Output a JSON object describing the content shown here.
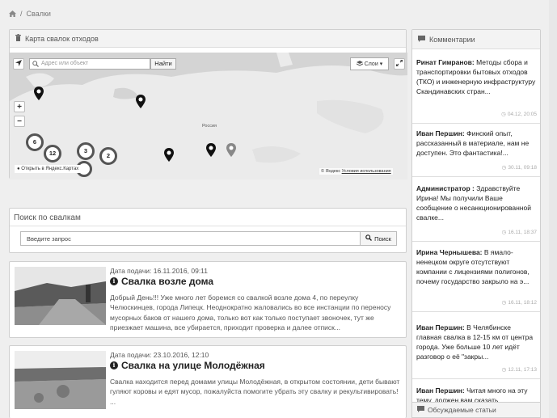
{
  "breadcrumb": {
    "separator": "/",
    "current": "Свалки"
  },
  "map_panel": {
    "title": "Карта свалок отходов",
    "search_placeholder": "Адрес или объект",
    "find_button": "Найти",
    "layers_button": "Слои",
    "zoom_in": "+",
    "zoom_out": "−",
    "clusters": [
      "6",
      "12",
      "3",
      "2"
    ],
    "country_label": "Россия",
    "open_link": "Открыть в Яндекс.Картах",
    "copyright": "© Яндекс",
    "terms": "Условия использования"
  },
  "search_panel": {
    "title": "Поиск по свалкам",
    "placeholder": "Введите запрос",
    "button": "Поиск"
  },
  "articles": [
    {
      "date": "Дата подачи: 16.11.2016, 09:11",
      "title": "Свалка возле дома",
      "excerpt": "Добрый День!!! Уже много лет боремся со свалкой возле дома 4, по переулку Челюскинцев, города Липецк. Неоднократно жаловались во все инстанции по переносу мусорных баков от нашего дома, только вот как только поступает звоночек, тут же приезжает машина, все убирается, приходит проверка и далее отписк..."
    },
    {
      "date": "Дата подачи: 23.10.2016, 12:10",
      "title": "Свалка на улице Молодёжная",
      "excerpt": "Свалка находится перед домами улицы Молодёжная, в открытом состоянии, дети бывают гуляют коровы и едят мусор, пожалуйста помогите убрать эту свалку и рекультивировать! ..."
    }
  ],
  "comments_panel": {
    "title": "Комментарии",
    "items": [
      {
        "author": "Ринат Гимранов:",
        "text": "Методы сбора и транспортировки бытовых отходов (ТКО) и инженерную инфраструктуру Скандинавских стран...",
        "date": "04.12, 20:05"
      },
      {
        "author": "Иван Першин:",
        "text": "Финский опыт, рассказанный в материале, нам не доступен. Это фантастика!...",
        "date": "30.11, 09:18"
      },
      {
        "author": "Администратор :",
        "text": "Здравствуйте Ирина! Мы получили Ваше сообщение о несанкционированной свалке...",
        "date": "16.11, 18:37"
      },
      {
        "author": "Ирина Чернышева:",
        "text": "В ямало-ненецком округе отсутствуют компании с лицензиями полигонов, почему государство закрыло на э...",
        "date": "16.11, 18:12"
      },
      {
        "author": "Иван Першин:",
        "text": "В Челябинске главная свалка в 12-15 км от центра города. Уже больше 10 лет идёт разговор о её \"закры...",
        "date": "12.11, 17:13"
      },
      {
        "author": "Иван Першин:",
        "text": "Читая много на эту тему, должен вам сказать...",
        "date": ""
      }
    ]
  },
  "discussed": {
    "title": "Обсуждаемые статьи"
  }
}
